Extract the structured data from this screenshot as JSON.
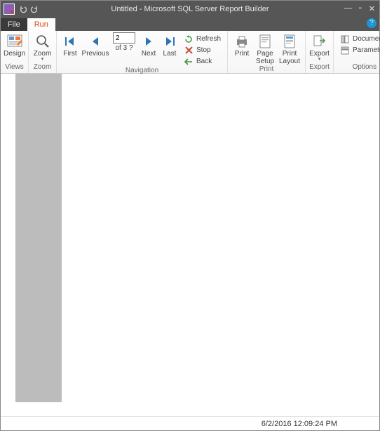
{
  "title": "Untitled - Microsoft SQL Server Report Builder",
  "tabs": {
    "file": "File",
    "run": "Run"
  },
  "ribbon": {
    "views": {
      "design": "Design",
      "label": "Views"
    },
    "zoom": {
      "zoom": "Zoom",
      "label": "Zoom"
    },
    "nav": {
      "first": "First",
      "previous": "Previous",
      "next": "Next",
      "last": "Last",
      "page_value": "2",
      "page_of": "of 3 ?",
      "refresh": "Refresh",
      "stop": "Stop",
      "back": "Back",
      "label": "Navigation"
    },
    "print": {
      "print": "Print",
      "page_setup": "Page\nSetup",
      "print_layout": "Print\nLayout",
      "label": "Print"
    },
    "export": {
      "export": "Export",
      "label": "Export"
    },
    "options": {
      "doc_map": "Document",
      "params": "Parameters",
      "label": "Options"
    }
  },
  "status": {
    "timestamp": "6/2/2016 12:09:24 PM"
  }
}
